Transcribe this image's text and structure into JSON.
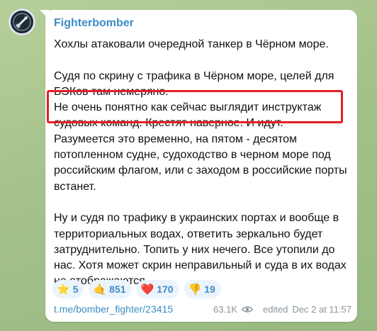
{
  "channel": {
    "name": "Fighterbomber",
    "avatar_icon": "fighterbomber-logo-icon"
  },
  "message": {
    "paragraphs": [
      "Хохлы атаковали очередной танкер в Чёрном море.",
      "Судя по скрину с трафика в Чёрном море, целей для БЭКов там немеряно.",
      "Не очень понятно как сейчас выглядит инструктаж судовых команд. Крестят наверное. И идут.",
      "Разумеется это временно, на пятом - десятом потопленном судне, судоходство в черном море под российским флагом, или с заходом в российские порты встанет.",
      "Ну и судя по трафику в украинских портах и вообще в территориальных водах, ответить зеркально будет затруднительно. Топить у них нечего. Все утопили до нас. Хотя может скрин неправильный и суда в их водах не отображаются."
    ]
  },
  "reactions": [
    {
      "emoji": "⭐",
      "icon": "star-icon",
      "count": "5"
    },
    {
      "emoji": "🤙",
      "icon": "call-me-hand-icon",
      "count": "851"
    },
    {
      "emoji": "❤️",
      "icon": "heart-icon",
      "count": "170"
    },
    {
      "emoji": "👎",
      "icon": "thumbs-down-icon",
      "count": "19"
    }
  ],
  "footer": {
    "link": "t.me/bomber_fighter/23415",
    "views": "63.1K",
    "views_icon": "eye-icon",
    "edited": "edited",
    "timestamp": "Dec 2 at 11:57"
  },
  "colors": {
    "accent": "#3d8cc4",
    "highlight": "#e31f26",
    "background": "#a9c48f"
  }
}
